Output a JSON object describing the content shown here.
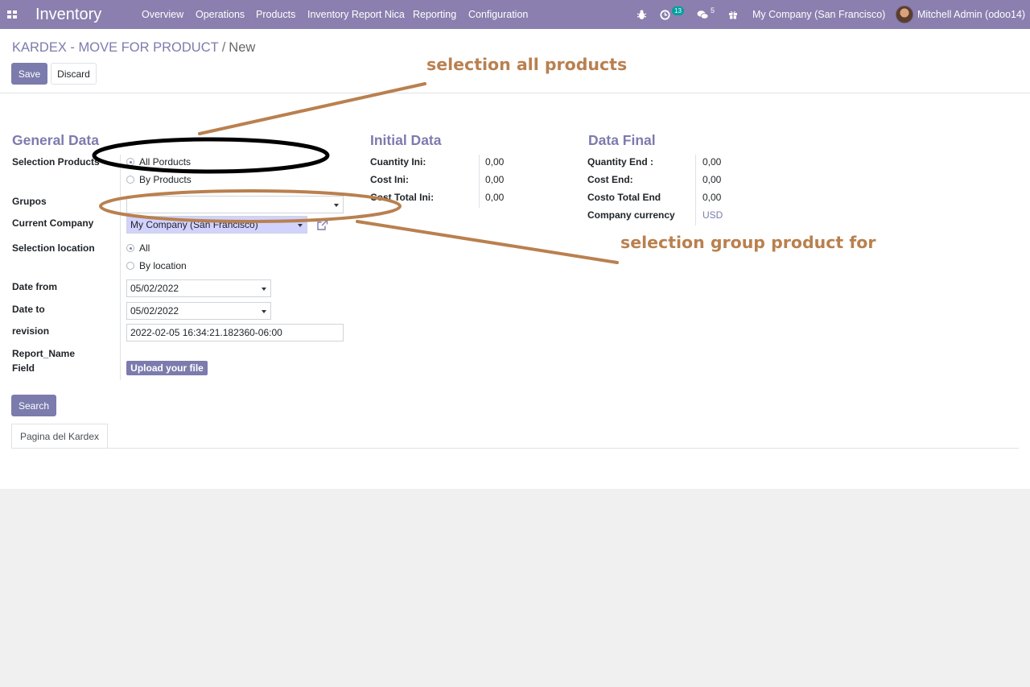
{
  "navbar": {
    "app_name": "Inventory",
    "menu": [
      "Overview",
      "Operations",
      "Products",
      "Inventory Report Nica",
      "Reporting",
      "Configuration"
    ],
    "activity_count": "13",
    "message_count": "5",
    "company": "My Company (San Francisco)",
    "user": "Mitchell Admin (odoo14)"
  },
  "breadcrumb": {
    "parent": "KARDEX - MOVE FOR PRODUCT",
    "separator": "/",
    "current": "New"
  },
  "buttons": {
    "save": "Save",
    "discard": "Discard",
    "search": "Search",
    "upload": "Upload your file"
  },
  "general": {
    "title": "General Data",
    "selection_products_label": "Selection Products",
    "selection_products_options": [
      "All Porducts",
      "By Products"
    ],
    "selection_products_selected": "All Porducts",
    "grupos_label": "Grupos",
    "grupos_value": "",
    "company_label": "Current Company",
    "company_value": "My Company (San Francisco)",
    "location_label": "Selection location",
    "location_options": [
      "All",
      "By location"
    ],
    "location_selected": "All",
    "date_from_label": "Date from",
    "date_from": "05/02/2022",
    "date_to_label": "Date to",
    "date_to": "05/02/2022",
    "revision_label": "revision",
    "revision": "2022-02-05 16:34:21.182360-06:00",
    "report_name_label_1": "Report_Name",
    "report_name_label_2": "Field"
  },
  "initial": {
    "title": "Initial Data",
    "rows": [
      {
        "label": "Cuantity Ini:",
        "value": "0,00"
      },
      {
        "label": "Cost Ini:",
        "value": "0,00"
      },
      {
        "label": "Cost Total Ini:",
        "value": "0,00"
      }
    ]
  },
  "final": {
    "title": "Data Final",
    "rows": [
      {
        "label": "Quantity End :",
        "value": "0,00"
      },
      {
        "label": "Cost End:",
        "value": "0,00"
      },
      {
        "label": "Costo Total End",
        "value": "0,00"
      },
      {
        "label": "Company currency",
        "value": "USD"
      }
    ]
  },
  "tabs": [
    "Pagina del Kardex"
  ],
  "annotations": {
    "note_all_products": "selection all products",
    "note_group": "selection group product for",
    "annotation_color": "#b9804f"
  },
  "colors": {
    "navbar": "#8a7fae",
    "primary": "#7c7bad",
    "required_field": "#d2d2ff"
  }
}
